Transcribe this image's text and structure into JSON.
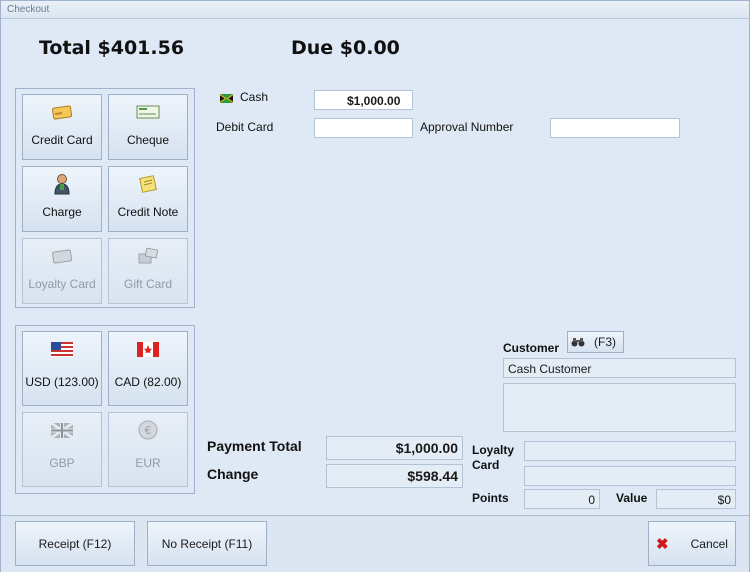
{
  "window": {
    "title": "Checkout"
  },
  "summary": {
    "total": "Total $401.56",
    "due": "Due $0.00"
  },
  "tenders": [
    {
      "label": "Credit Card",
      "icon": "credit-card-icon",
      "enabled": true
    },
    {
      "label": "Cheque",
      "icon": "cheque-icon",
      "enabled": true
    },
    {
      "label": "Charge",
      "icon": "person-icon",
      "enabled": true
    },
    {
      "label": "Credit Note",
      "icon": "note-icon",
      "enabled": true
    },
    {
      "label": "Loyalty Card",
      "icon": "loyalty-card-icon",
      "enabled": false
    },
    {
      "label": "Gift Card",
      "icon": "gift-card-icon",
      "enabled": false
    }
  ],
  "currencies": [
    {
      "label": "USD (123.00)",
      "icon": "us-flag-icon",
      "enabled": true
    },
    {
      "label": "CAD (82.00)",
      "icon": "canada-flag-icon",
      "enabled": true
    },
    {
      "label": "GBP",
      "icon": "uk-flag-icon",
      "enabled": false
    },
    {
      "label": "EUR",
      "icon": "euro-icon",
      "enabled": false
    }
  ],
  "payment": {
    "cash_label": "Cash",
    "cash_value": "$1,000.00",
    "debit_label": "Debit Card",
    "debit_value": "",
    "approval_label": "Approval Number",
    "approval_value": ""
  },
  "totals": {
    "payment_total_label": "Payment Total",
    "payment_total_value": "$1,000.00",
    "change_label": "Change",
    "change_value": "$598.44"
  },
  "customer": {
    "label": "Customer",
    "lookup_label": "(F3)",
    "name": "Cash Customer",
    "notes": "",
    "loyalty_label": "Loyalty Card",
    "loyalty_value": "",
    "loyalty_value2": "",
    "points_label": "Points",
    "points_value": "0",
    "value_label": "Value",
    "value_value": "$0"
  },
  "buttons": {
    "receipt": "Receipt (F12)",
    "no_receipt": "No Receipt (F11)",
    "cancel": "Cancel"
  }
}
